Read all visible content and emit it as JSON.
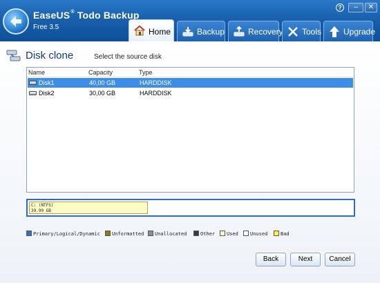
{
  "app": {
    "name": "EaseUS",
    "reg": "®",
    "name2": "Todo Backup",
    "version": "Free 3.5"
  },
  "window_controls": {
    "help": "?",
    "minimize": "–",
    "close": "✕"
  },
  "tabs": [
    {
      "label": "Home",
      "icon": "home-icon",
      "active": true
    },
    {
      "label": "Backup",
      "icon": "backup-icon"
    },
    {
      "label": "Recovery",
      "icon": "recovery-icon"
    },
    {
      "label": "Tools",
      "icon": "tools-icon"
    },
    {
      "label": "Upgrade",
      "icon": "upgrade-icon"
    }
  ],
  "page": {
    "title": "Disk clone",
    "subtitle": "Select the source disk"
  },
  "table": {
    "columns": [
      "Name",
      "Capacity",
      "Type"
    ],
    "rows": [
      {
        "name": "Disk1",
        "capacity": "40,00 GB",
        "type": "HARDDISK",
        "selected": true
      },
      {
        "name": "Disk2",
        "capacity": "30,00 GB",
        "type": "HARDDISK",
        "selected": false
      }
    ]
  },
  "disk_map": {
    "partition_label": "C:  (NTFS)",
    "partition_size": "39.99 GB"
  },
  "legend": [
    {
      "label": "Primary/Logical/Dynamic",
      "color": "#2f72c8"
    },
    {
      "label": "Unformatted",
      "color": "#8a7d10"
    },
    {
      "label": "Unallocated",
      "color": "#909090"
    },
    {
      "label": "Other",
      "color": "#3a3a3a"
    },
    {
      "label": "Used",
      "color": "#fffbc8"
    },
    {
      "label": "Unused",
      "color": "#ffffff"
    },
    {
      "label": "Bad",
      "color": "#ffee44"
    }
  ],
  "buttons": {
    "back": "Back",
    "next": "Next",
    "cancel": "Cancel"
  }
}
